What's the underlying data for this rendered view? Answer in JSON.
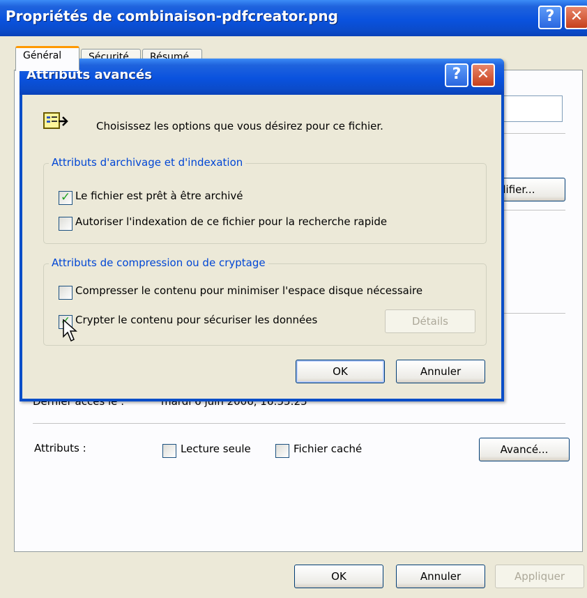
{
  "outer": {
    "title": "Propriétés de combinaison-pdfcreator.png",
    "help_glyph": "?",
    "close_glyph": "✕",
    "tabs": [
      "Général",
      "Sécurité",
      "Résumé"
    ],
    "modify_button_partial": "difier...",
    "last_access_label": "Dernier accès le :",
    "last_access_value": "mardi 6 juin 2006, 16:55:25",
    "attributes_label": "Attributs :",
    "readonly_label": "Lecture seule",
    "hidden_label": "Fichier caché",
    "advanced_button": "Avancé...",
    "ok_button": "OK",
    "cancel_button": "Annuler",
    "apply_button": "Appliquer",
    "readonly_checked": false,
    "hidden_checked": false
  },
  "dialog": {
    "title": "Attributs avancés",
    "help_glyph": "?",
    "close_glyph": "✕",
    "instruction": "Choisissez les options que vous désirez pour ce fichier.",
    "group_archive": {
      "title": "Attributs d'archivage et d'indexation",
      "options": [
        {
          "label": "Le fichier est prêt à être archivé",
          "checked": true
        },
        {
          "label": "Autoriser l'indexation de ce fichier pour la recherche rapide",
          "checked": false
        }
      ]
    },
    "group_compress": {
      "title": "Attributs de compression ou de cryptage",
      "options": [
        {
          "label": "Compresser le contenu pour minimiser l'espace disque nécessaire",
          "checked": false
        },
        {
          "label": "Crypter le contenu pour sécuriser les données",
          "checked": true
        }
      ],
      "details_button": "Détails"
    },
    "ok_button": "OK",
    "cancel_button": "Annuler"
  },
  "colors": {
    "title_bar": "#0a52de",
    "window_bg": "#ece9d8",
    "group_title": "#0046d5",
    "check_mark": "#21a121"
  },
  "icons": {
    "help": "help-icon",
    "close": "close-icon",
    "properties": "properties-icon",
    "cursor": "mouse-cursor-icon"
  }
}
